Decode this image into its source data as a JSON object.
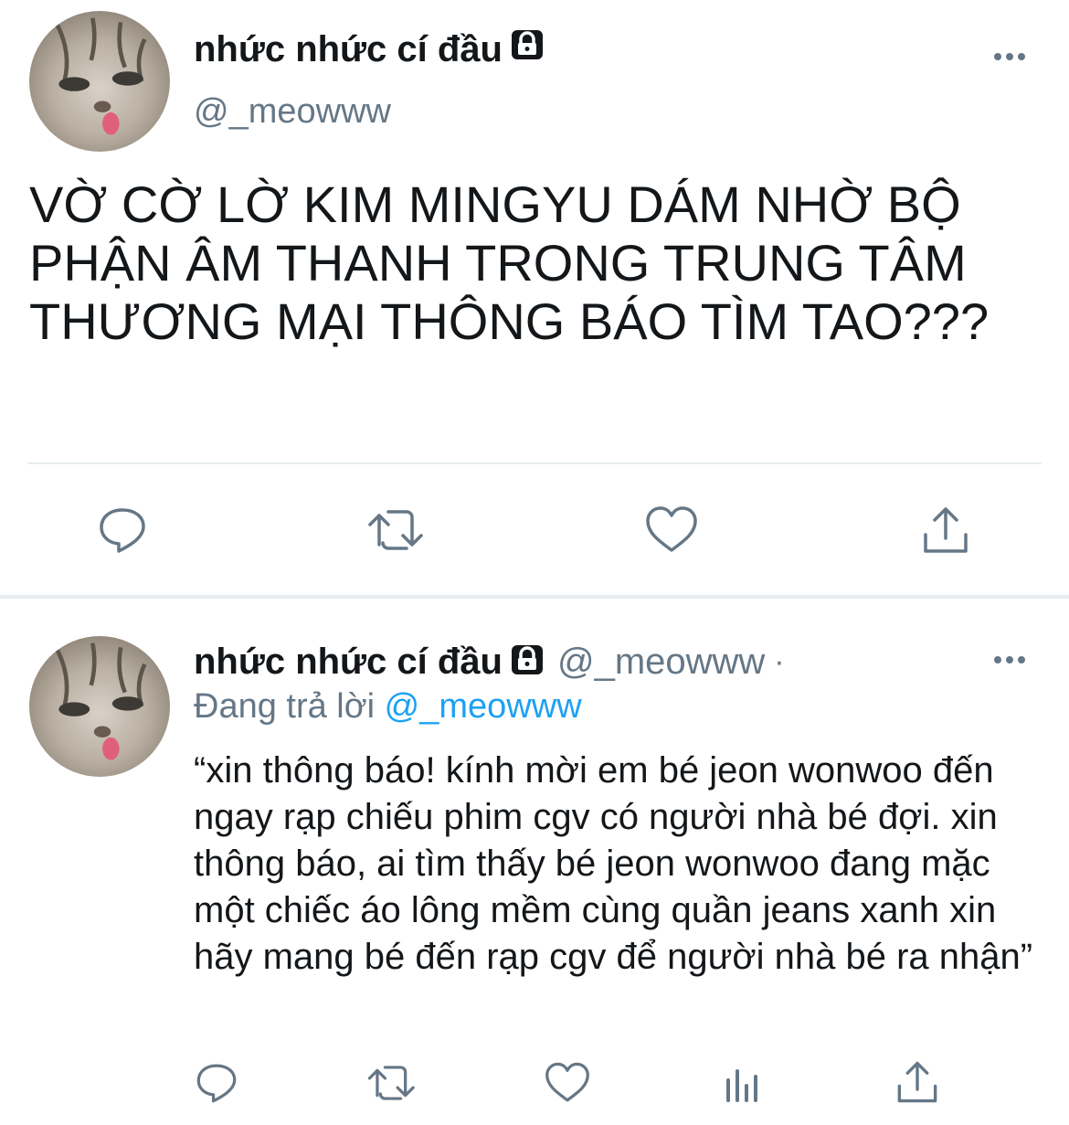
{
  "tweet": {
    "display_name": "nhức nhức cí đầu",
    "handle": "@_meowww",
    "text": "VỜ CỜ LỜ KIM MINGYU DÁM NHỜ BỘ PHẬN ÂM THANH TRONG TRUNG TÂM THƯƠNG MẠI THÔNG BÁO TÌM TAO???",
    "locked": true
  },
  "reply": {
    "display_name": "nhức nhức cí đầu",
    "handle": "@_meowww",
    "separator": "·",
    "replying_prefix": "Đang trả lời",
    "replying_to": "@_meowww",
    "text": "“xin thông báo! kính mời em bé jeon wonwoo đến ngay rạp chiếu phim cgv có người nhà bé đợi. xin thông báo, ai tìm thấy bé jeon wonwoo đang mặc một chiếc áo lông mềm cùng quần jeans xanh xin hãy mang bé đến rạp cgv để người nhà bé ra nhận”"
  },
  "icons": {
    "main_actions": [
      "reply-icon",
      "retweet-icon",
      "like-icon",
      "share-icon"
    ],
    "reply_actions": [
      "reply-icon",
      "retweet-icon",
      "like-icon",
      "analytics-icon",
      "share-icon"
    ],
    "more": "more-icon",
    "lock": "lock-icon"
  },
  "colors": {
    "text": "#14171a",
    "secondary": "#657786",
    "accent": "#1da1f2",
    "divider": "#e6ecf0"
  }
}
